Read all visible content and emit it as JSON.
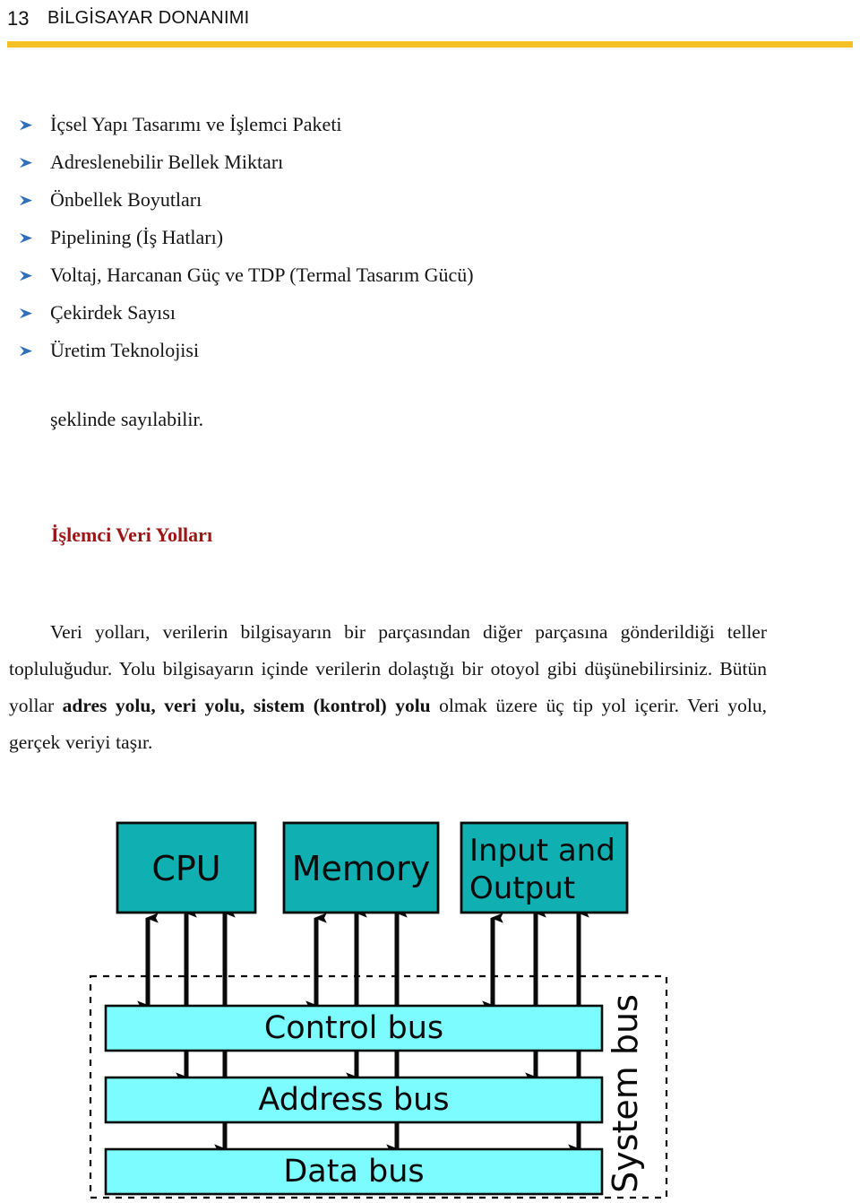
{
  "header": {
    "page_number": "13",
    "title": "BİLGİSAYAR DONANIMI",
    "rule_color": "#F5C124"
  },
  "bullet_list": {
    "marker_icon": "chevron-right-arrow-icon",
    "marker_color": "#2F6FBA",
    "items": [
      {
        "label": "İçsel Yapı Tasarımı ve İşlemci Paketi"
      },
      {
        "label": "Adreslenebilir Bellek Miktarı"
      },
      {
        "label": "Önbellek Boyutları"
      },
      {
        "label": "Pipelining (İş Hatları)"
      },
      {
        "label": "Voltaj, Harcanan Güç ve TDP (Termal Tasarım Gücü)"
      },
      {
        "label": "Çekirdek Sayısı"
      },
      {
        "label": "Üretim Teknolojisi"
      }
    ],
    "closing_line": "şeklinde sayılabilir."
  },
  "section": {
    "heading": "İşlemci Veri Yolları",
    "heading_color": "#9C1616",
    "paragraph": {
      "part1": "Veri yolları, verilerin bilgisayarın bir parçasından diğer parçasına gönderildiği teller topluluğudur. Yolu bilgisayarın içinde verilerin dolaştığı bir otoyol gibi düşünebilirsiniz. Bütün yollar ",
      "emphasis": "adres yolu, veri yolu,  sistem (kontrol) yolu",
      "part2": " olmak üzere üç tip yol içerir. Veri yolu, gerçek veriyi taşır."
    }
  },
  "diagram": {
    "name": "system-bus-diagram",
    "unit_box_fill": "#0FAFB2",
    "bus_bar_fill": "#7DFCFF",
    "stroke_color": "#0a0a0a",
    "units": [
      {
        "id": "cpu",
        "label": "CPU",
        "lines": [
          "CPU"
        ]
      },
      {
        "id": "memory",
        "label": "Memory",
        "lines": [
          "Memory"
        ]
      },
      {
        "id": "input-output",
        "label": "Input and Output",
        "lines": [
          "Input and",
          "Output"
        ]
      }
    ],
    "buses": [
      {
        "id": "control-bus",
        "label": "Control bus"
      },
      {
        "id": "address-bus",
        "label": "Address bus"
      },
      {
        "id": "data-bus",
        "label": "Data bus"
      }
    ],
    "enclosure_label": "System bus"
  }
}
